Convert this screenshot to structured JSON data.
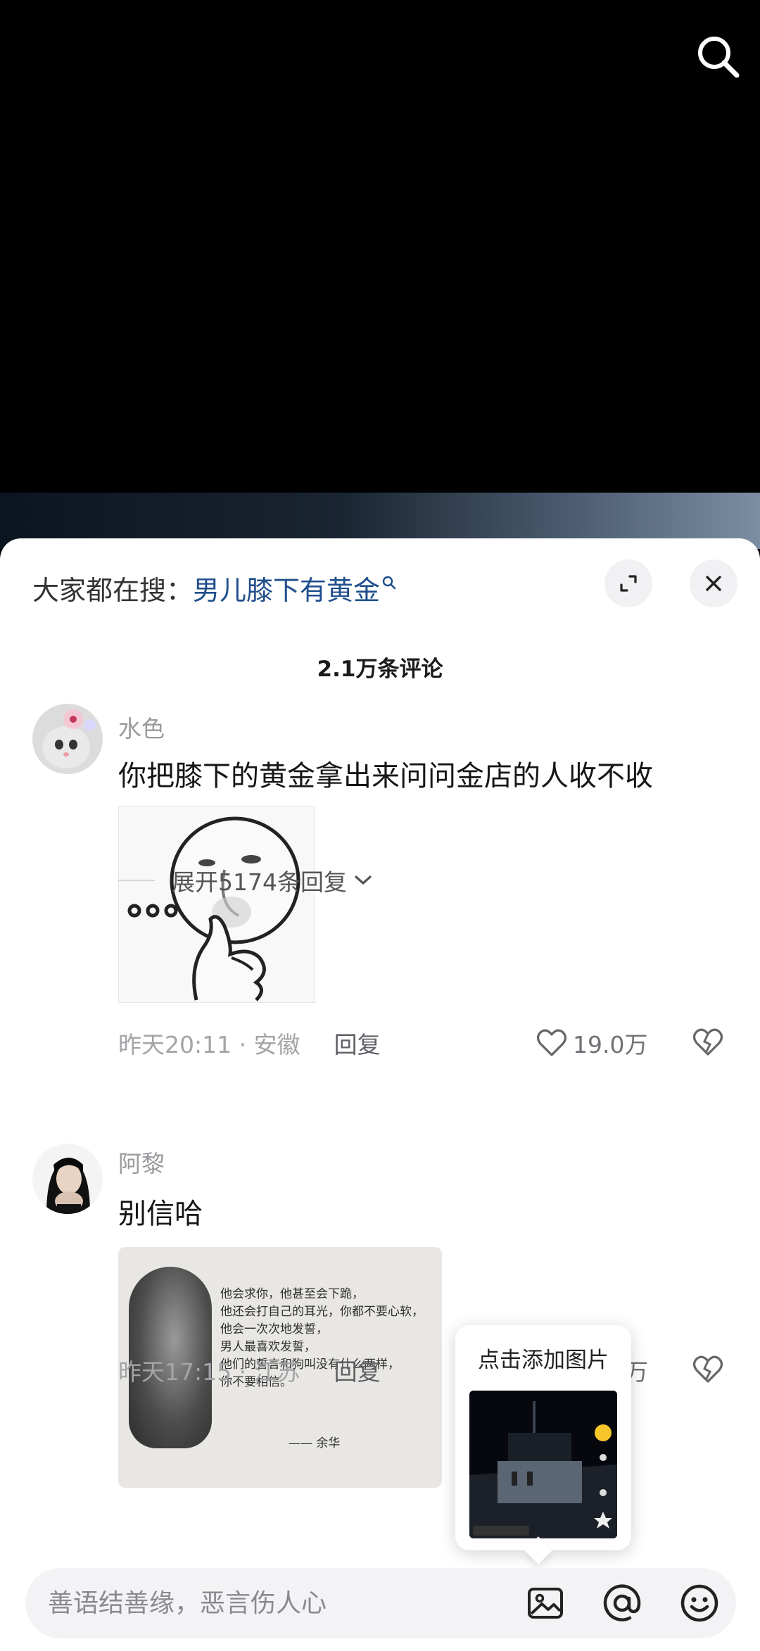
{
  "top": {
    "search_icon": "search-icon"
  },
  "sheet": {
    "trending_prefix": "大家都在搜：",
    "trending_query": "男儿膝下有黄金",
    "expand_icon": "expand-icon",
    "close_icon": "close-icon",
    "comment_count": "2.1万条评论"
  },
  "comments": [
    {
      "username": "水色",
      "text": "你把膝下的黄金拿出来问问金店的人收不收",
      "meta": "昨天20:11 · 安徽",
      "reply_label": "回复",
      "likes": "19.0万",
      "expand_replies": "展开5174条回复"
    },
    {
      "username": "阿黎",
      "text": "别信哈",
      "meta": "昨天17:15 · 江苏",
      "reply_label": "回复",
      "likes_partial": "万",
      "image_poem": [
        "他会求你，他甚至会下跪，",
        "他还会打自己的耳光，你都不要心软，",
        "他会一次次地发誓，",
        "男人最喜欢发誓，",
        "他们的誓言和狗叫没有什么两样，",
        "你不要相信。"
      ],
      "image_author": "—— 余华"
    }
  ],
  "popup": {
    "title": "点击添加图片"
  },
  "input_bar": {
    "placeholder": "善语结善缘，恶言伤人心",
    "image_icon": "image-icon",
    "at_icon": "at-icon",
    "emoji_icon": "emoji-icon"
  },
  "colors": {
    "link_blue": "#1f4e8c",
    "muted_gray": "#a4a4a8",
    "sheet_bg": "#ffffff"
  }
}
